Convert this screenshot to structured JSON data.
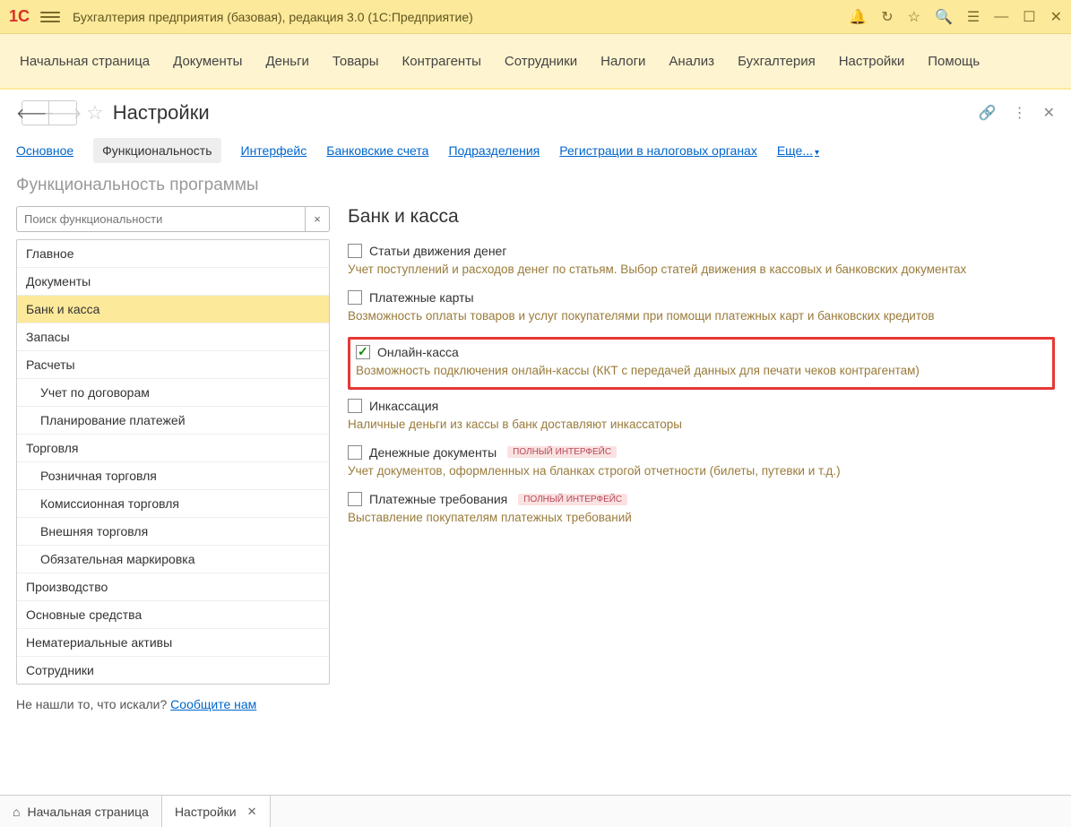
{
  "titlebar": {
    "title": "Бухгалтерия предприятия (базовая), редакция 3.0  (1С:Предприятие)"
  },
  "mainnav": [
    "Начальная страница",
    "Документы",
    "Деньги",
    "Товары",
    "Контрагенты",
    "Сотрудники",
    "Налоги",
    "Анализ",
    "Бухгалтерия",
    "Настройки",
    "Помощь"
  ],
  "page": {
    "title": "Настройки"
  },
  "tabs": {
    "items": [
      "Основное",
      "Функциональность",
      "Интерфейс",
      "Банковские счета",
      "Подразделения",
      "Регистрации в налоговых органах"
    ],
    "more": "Еще..."
  },
  "section_title": "Функциональность программы",
  "search": {
    "placeholder": "Поиск функциональности"
  },
  "tree": [
    {
      "label": "Главное",
      "child": false
    },
    {
      "label": "Документы",
      "child": false
    },
    {
      "label": "Банк и касса",
      "child": false,
      "selected": true
    },
    {
      "label": "Запасы",
      "child": false
    },
    {
      "label": "Расчеты",
      "child": false
    },
    {
      "label": "Учет по договорам",
      "child": true
    },
    {
      "label": "Планирование платежей",
      "child": true
    },
    {
      "label": "Торговля",
      "child": false
    },
    {
      "label": "Розничная торговля",
      "child": true
    },
    {
      "label": "Комиссионная торговля",
      "child": true
    },
    {
      "label": "Внешняя торговля",
      "child": true
    },
    {
      "label": "Обязательная маркировка",
      "child": true
    },
    {
      "label": "Производство",
      "child": false
    },
    {
      "label": "Основные средства",
      "child": false
    },
    {
      "label": "Нематериальные активы",
      "child": false
    },
    {
      "label": "Сотрудники",
      "child": false
    }
  ],
  "right": {
    "title": "Банк и касса",
    "settings": [
      {
        "label": "Статьи движения денег",
        "desc": "Учет поступлений и расходов денег по статьям.\nВыбор статей движения в кассовых и банковских документах",
        "checked": false,
        "badge": "",
        "hl": false
      },
      {
        "label": "Платежные карты",
        "desc": "Возможность оплаты товаров и услуг покупателями при помощи платежных карт и банковских кредитов",
        "checked": false,
        "badge": "",
        "hl": false
      },
      {
        "label": "Онлайн-касса",
        "desc": "Возможность подключения онлайн-кассы (ККТ с передачей данных для печати чеков контрагентам)",
        "checked": true,
        "badge": "",
        "hl": true
      },
      {
        "label": "Инкассация",
        "desc": "Наличные деньги из кассы в банк доставляют инкассаторы",
        "checked": false,
        "badge": "",
        "hl": false
      },
      {
        "label": "Денежные документы",
        "desc": "Учет документов, оформленных на бланках строгой отчетности (билеты, путевки и т.д.)",
        "checked": false,
        "badge": "ПОЛНЫЙ ИНТЕРФЕЙС",
        "hl": false
      },
      {
        "label": "Платежные требования",
        "desc": "Выставление покупателям платежных требований",
        "checked": false,
        "badge": "ПОЛНЫЙ ИНТЕРФЕЙС",
        "hl": false
      }
    ]
  },
  "footnote": {
    "text": "Не нашли то, что искали?  ",
    "link": "Сообщите нам"
  },
  "bottom_tabs": {
    "home": "Начальная страница",
    "active": "Настройки"
  }
}
